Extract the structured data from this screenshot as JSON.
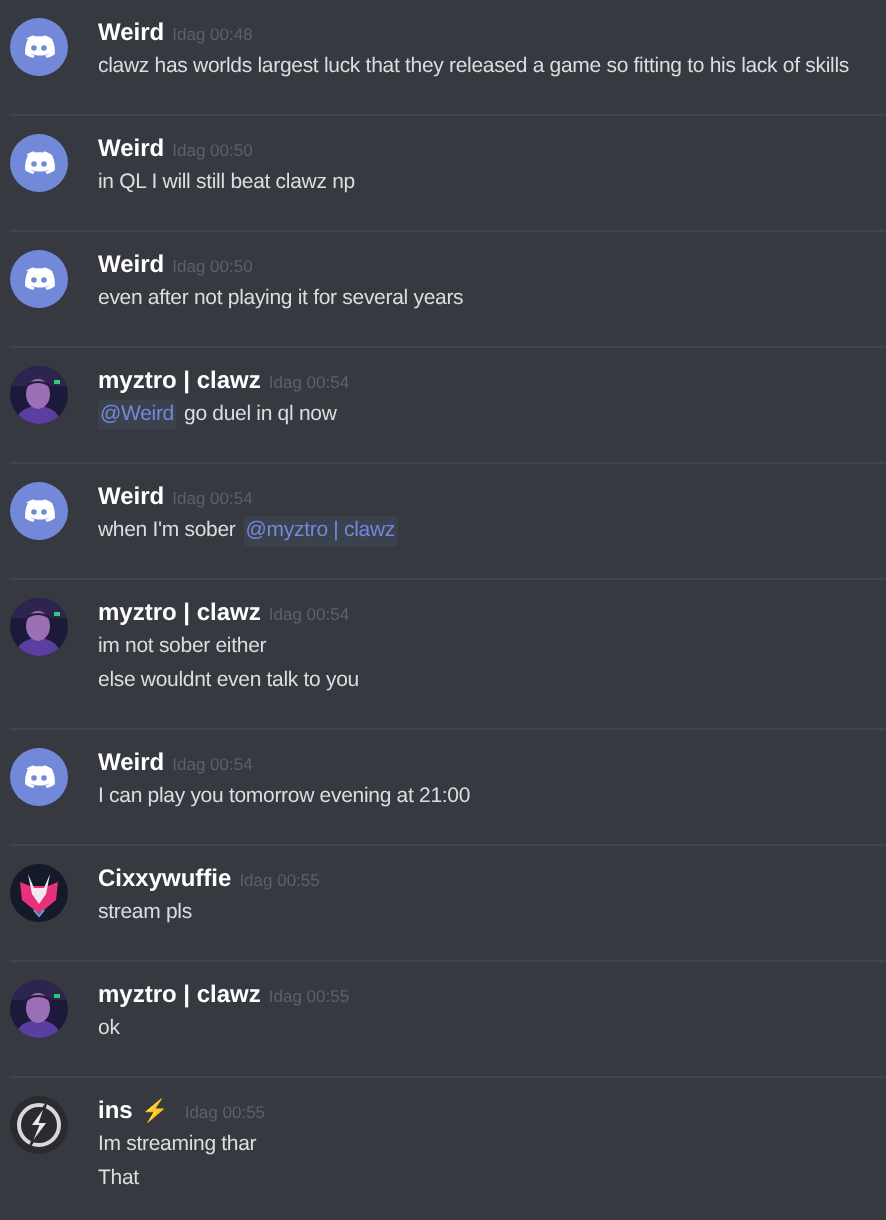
{
  "messages": [
    {
      "author": "Weird",
      "kind": "discord",
      "time": "Idag 00:48",
      "lines": [
        [
          {
            "kind": "text",
            "text": "clawz has worlds largest luck that they released a game so fitting to his lack of skills"
          }
        ]
      ]
    },
    {
      "author": "Weird",
      "kind": "discord",
      "time": "Idag 00:50",
      "lines": [
        [
          {
            "kind": "text",
            "text": "in QL I will still beat clawz np"
          }
        ]
      ]
    },
    {
      "author": "Weird",
      "kind": "discord",
      "time": "Idag 00:50",
      "lines": [
        [
          {
            "kind": "text",
            "text": "even after not playing it for several years"
          }
        ]
      ]
    },
    {
      "author": "myztro | clawz",
      "time": "Idag 00:54",
      "lines": [
        [
          {
            "kind": "mention",
            "text": "@Weird"
          },
          {
            "kind": "text",
            "text": "go duel in ql now"
          }
        ]
      ]
    },
    {
      "author": "Weird",
      "kind": "discord",
      "time": "Idag 00:54",
      "lines": [
        [
          {
            "kind": "text",
            "text": "when I'm sober"
          },
          {
            "kind": "mention",
            "text": "@myztro | clawz"
          }
        ]
      ]
    },
    {
      "author": "myztro | clawz",
      "time": "Idag 00:54",
      "lines": [
        [
          {
            "kind": "text",
            "text": "im not sober either"
          }
        ],
        [
          {
            "kind": "text",
            "text": "else wouldnt even talk to you"
          }
        ]
      ]
    },
    {
      "author": "Weird",
      "kind": "discord",
      "time": "Idag 00:54",
      "lines": [
        [
          {
            "kind": "text",
            "text": "I can play you tomorrow evening at 21:00"
          }
        ]
      ]
    },
    {
      "author": "Cixxywuffie",
      "kind": "wolf",
      "time": "Idag 00:55",
      "lines": [
        [
          {
            "kind": "text",
            "text": "stream pls"
          }
        ]
      ]
    },
    {
      "author": "myztro | clawz",
      "time": "Idag 00:55",
      "lines": [
        [
          {
            "kind": "text",
            "text": "ok"
          }
        ]
      ]
    },
    {
      "author": "ins",
      "badge": "⚡",
      "kind": "bolt",
      "time": "Idag 00:55",
      "lines": [
        [
          {
            "kind": "text",
            "text": "Im streaming thar"
          }
        ],
        [
          {
            "kind": "text",
            "text": "That"
          }
        ]
      ]
    }
  ]
}
